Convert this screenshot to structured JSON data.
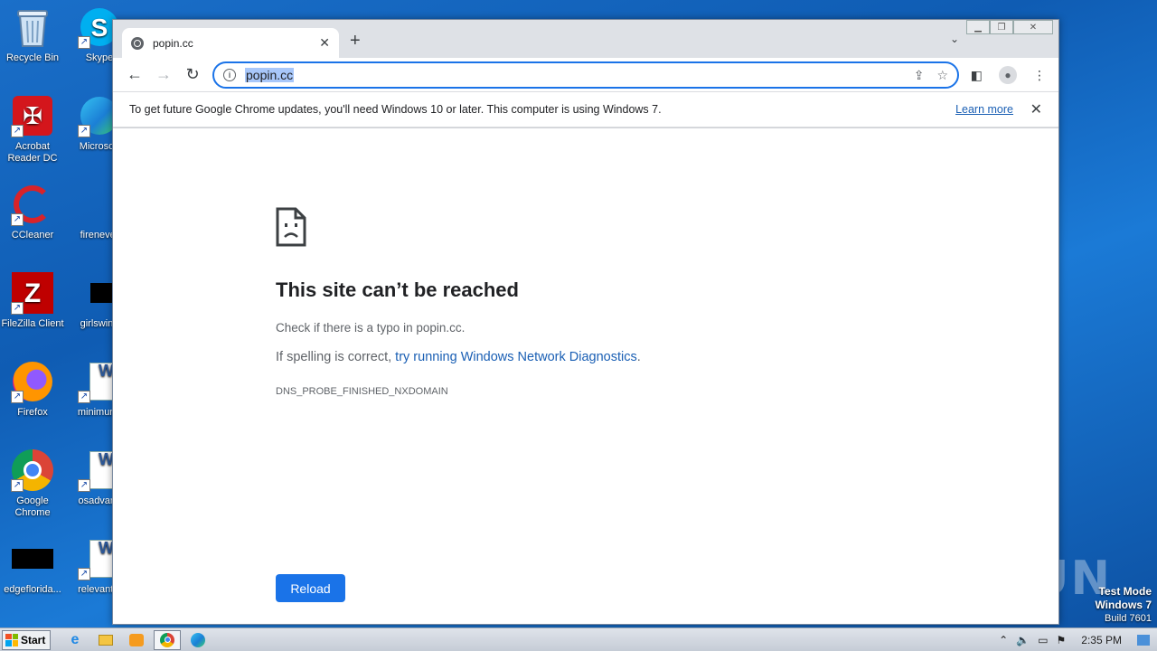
{
  "desktop": {
    "icons": [
      {
        "label": "Recycle Bin"
      },
      {
        "label": "Skype"
      },
      {
        "label": "Acrobat Reader DC"
      },
      {
        "label": "Microsoft"
      },
      {
        "label": "CCleaner"
      },
      {
        "label": "firenever"
      },
      {
        "label": "FileZilla Client"
      },
      {
        "label": "girlswine"
      },
      {
        "label": "Firefox"
      },
      {
        "label": "minimumr"
      },
      {
        "label": "Google Chrome"
      },
      {
        "label": "osadvanc"
      },
      {
        "label": "edgeflorida..."
      },
      {
        "label": "relevantin"
      }
    ],
    "watermark": "ANY RUN",
    "test_mode": {
      "line1": "Test Mode",
      "line2": "Windows 7",
      "line3": "Build 7601"
    }
  },
  "browser": {
    "tab_title": "popin.cc",
    "address": "popin.cc",
    "infobar": {
      "message": "To get future Google Chrome updates, you'll need Windows 10 or later. This computer is using Windows 7.",
      "learn_more": "Learn more"
    },
    "error": {
      "title": "This site can’t be reached",
      "line1": "Check if there is a typo in popin.cc.",
      "line2_prefix": "If spelling is correct, ",
      "line2_link": "try running Windows Network Diagnostics",
      "line2_suffix": ".",
      "code": "DNS_PROBE_FINISHED_NXDOMAIN",
      "reload": "Reload"
    }
  },
  "taskbar": {
    "start_label": "Start",
    "clock": "2:35 PM"
  },
  "colors": {
    "accent": "#1a73e8",
    "link": "#1a5fb4",
    "desktop": "#1565c0"
  }
}
